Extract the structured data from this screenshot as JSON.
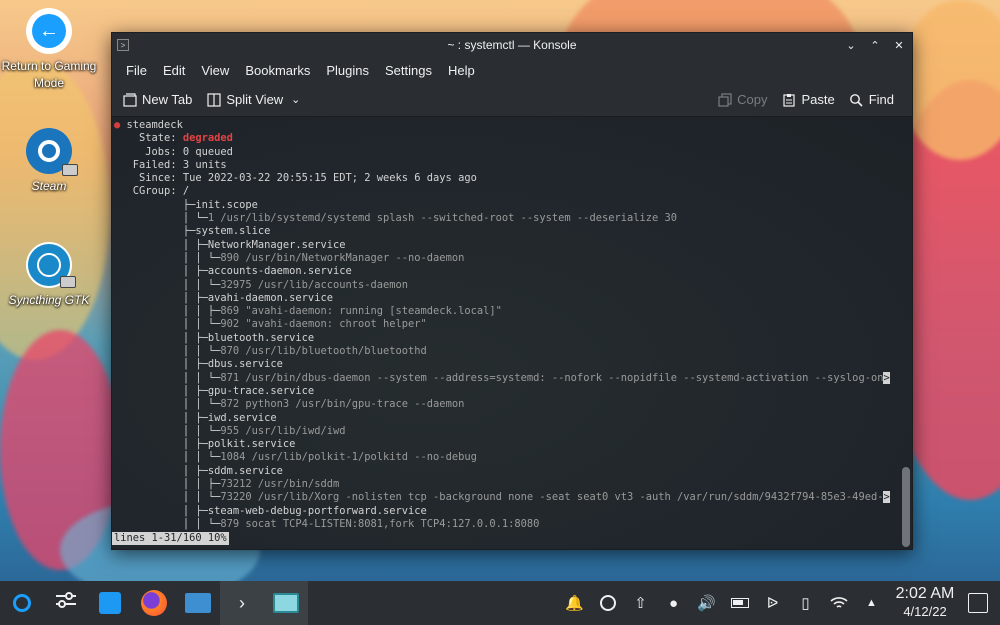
{
  "desktop": {
    "icons": [
      {
        "label": "Return to Gaming Mode"
      },
      {
        "label": "Steam"
      },
      {
        "label": "Syncthing GTK"
      }
    ]
  },
  "window": {
    "title": "~ : systemctl — Konsole",
    "menu": [
      "File",
      "Edit",
      "View",
      "Bookmarks",
      "Plugins",
      "Settings",
      "Help"
    ],
    "toolbar": {
      "new_tab": "New Tab",
      "split_view": "Split View",
      "copy": "Copy",
      "paste": "Paste",
      "find": "Find"
    }
  },
  "terminal": {
    "lines": [
      "● steamdeck",
      "    State: degraded",
      "     Jobs: 0 queued",
      "   Failed: 3 units",
      "    Since: Tue 2022-03-22 20:55:15 EDT; 2 weeks 6 days ago",
      "   CGroup: /",
      "           ├─init.scope",
      "           │ └─1 /usr/lib/systemd/systemd splash --switched-root --system --deserialize 30",
      "           ├─system.slice",
      "           │ ├─NetworkManager.service",
      "           │ │ └─890 /usr/bin/NetworkManager --no-daemon",
      "           │ ├─accounts-daemon.service",
      "           │ │ └─32975 /usr/lib/accounts-daemon",
      "           │ ├─avahi-daemon.service",
      "           │ │ ├─869 \"avahi-daemon: running [steamdeck.local]\"",
      "           │ │ └─902 \"avahi-daemon: chroot helper\"",
      "           │ ├─bluetooth.service",
      "           │ │ └─870 /usr/lib/bluetooth/bluetoothd",
      "           │ ├─dbus.service",
      "           │ │ └─871 /usr/bin/dbus-daemon --system --address=systemd: --nofork --nopidfile --systemd-activation --syslog-on",
      "           │ ├─gpu-trace.service",
      "           │ │ └─872 python3 /usr/bin/gpu-trace --daemon",
      "           │ ├─iwd.service",
      "           │ │ └─955 /usr/lib/iwd/iwd",
      "           │ ├─polkit.service",
      "           │ │ └─1084 /usr/lib/polkit-1/polkitd --no-debug",
      "           │ ├─sddm.service",
      "           │ │ ├─73212 /usr/bin/sddm",
      "           │ │ └─73220 /usr/lib/Xorg -nolisten tcp -background none -seat seat0 vt3 -auth /var/run/sddm/9432f794-85e3-49ed-",
      "           │ ├─steam-web-debug-portforward.service",
      "           │ │ └─879 socat TCP4-LISTEN:8081,fork TCP4:127.0.0.1:8080"
    ],
    "status": "lines 1-31/160 10%",
    "truncation_marker": ">"
  },
  "taskbar": {
    "clock_time": "2:02 AM",
    "clock_date": "4/12/22"
  },
  "colors": {
    "window_bg": "#232629",
    "accent_red": "#e24444",
    "taskbar_bg": "#2b2f33"
  }
}
